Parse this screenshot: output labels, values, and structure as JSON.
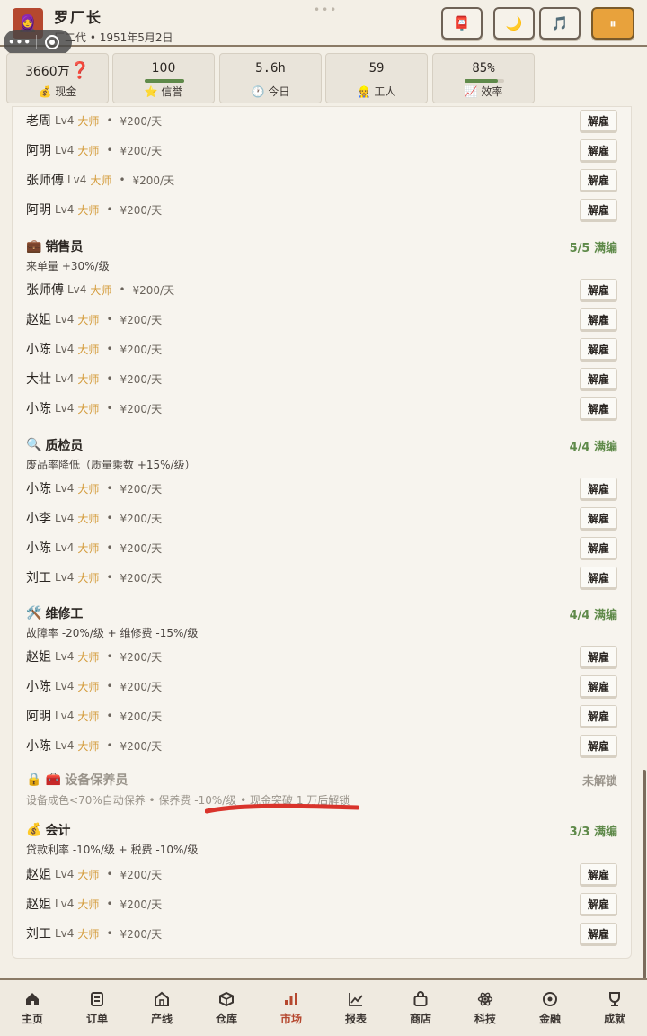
{
  "header": {
    "avatar_emoji": "🧕",
    "title": "罗厂长",
    "subtitle": "厂二代 • 1951年5月2日",
    "drag_dots": "•••",
    "capsule_dots": "•••",
    "buttons": [
      {
        "icon": "📮",
        "name": "mailbox-button"
      },
      {
        "icon": "🌙",
        "name": "night-mode-button"
      },
      {
        "icon": "🎵",
        "name": "music-button"
      },
      {
        "icon": "⏸",
        "name": "pause-button"
      }
    ]
  },
  "stats": [
    {
      "value": "3660万",
      "extra": "❓",
      "icon": "💰",
      "label": "现金"
    },
    {
      "value": "100",
      "icon": "⭐",
      "label": "信誉",
      "bar": 1.0
    },
    {
      "value": "5.6h",
      "icon": "🕐",
      "label": "今日"
    },
    {
      "value": "59",
      "icon": "👷",
      "label": "工人"
    },
    {
      "value": "85%",
      "icon": "📈",
      "label": "效率",
      "bar": 0.85
    }
  ],
  "fire_label": "解雇",
  "sections": [
    {
      "workers": [
        {
          "name": "老周",
          "level": "Lv4",
          "rank": "大师",
          "wage": "¥200/天"
        },
        {
          "name": "阿明",
          "level": "Lv4",
          "rank": "大师",
          "wage": "¥200/天"
        },
        {
          "name": "张师傅",
          "level": "Lv4",
          "rank": "大师",
          "wage": "¥200/天"
        },
        {
          "name": "阿明",
          "level": "Lv4",
          "rank": "大师",
          "wage": "¥200/天"
        }
      ]
    },
    {
      "icon": "💼",
      "title": "销售员",
      "count": "5/5 满编",
      "desc": "来单量 +30%/级",
      "workers": [
        {
          "name": "张师傅",
          "level": "Lv4",
          "rank": "大师",
          "wage": "¥200/天"
        },
        {
          "name": "赵姐",
          "level": "Lv4",
          "rank": "大师",
          "wage": "¥200/天"
        },
        {
          "name": "小陈",
          "level": "Lv4",
          "rank": "大师",
          "wage": "¥200/天"
        },
        {
          "name": "大壮",
          "level": "Lv4",
          "rank": "大师",
          "wage": "¥200/天"
        },
        {
          "name": "小陈",
          "level": "Lv4",
          "rank": "大师",
          "wage": "¥200/天"
        }
      ]
    },
    {
      "icon": "🔍",
      "title": "质检员",
      "count": "4/4 满编",
      "desc": "废品率降低（质量乘数 +15%/级）",
      "workers": [
        {
          "name": "小陈",
          "level": "Lv4",
          "rank": "大师",
          "wage": "¥200/天"
        },
        {
          "name": "小李",
          "level": "Lv4",
          "rank": "大师",
          "wage": "¥200/天"
        },
        {
          "name": "小陈",
          "level": "Lv4",
          "rank": "大师",
          "wage": "¥200/天"
        },
        {
          "name": "刘工",
          "level": "Lv4",
          "rank": "大师",
          "wage": "¥200/天"
        }
      ]
    },
    {
      "icon": "🛠️",
      "title": "维修工",
      "count": "4/4 满编",
      "desc": "故障率 -20%/级 + 维修费 -15%/级",
      "workers": [
        {
          "name": "赵姐",
          "level": "Lv4",
          "rank": "大师",
          "wage": "¥200/天"
        },
        {
          "name": "小陈",
          "level": "Lv4",
          "rank": "大师",
          "wage": "¥200/天"
        },
        {
          "name": "阿明",
          "level": "Lv4",
          "rank": "大师",
          "wage": "¥200/天"
        },
        {
          "name": "小陈",
          "level": "Lv4",
          "rank": "大师",
          "wage": "¥200/天"
        }
      ]
    },
    {
      "icon": "🔒 🧰",
      "title": "设备保养员",
      "count": "未解锁",
      "desc": "设备成色<70%自动保养 • 保养费 -10%/级 • 现金突破 1 万后解锁",
      "locked": true,
      "workers": []
    },
    {
      "icon": "💰",
      "title": "会计",
      "count": "3/3 满编",
      "desc": "贷款利率 -10%/级 + 税费 -10%/级",
      "workers": [
        {
          "name": "赵姐",
          "level": "Lv4",
          "rank": "大师",
          "wage": "¥200/天"
        },
        {
          "name": "赵姐",
          "level": "Lv4",
          "rank": "大师",
          "wage": "¥200/天"
        },
        {
          "name": "刘工",
          "level": "Lv4",
          "rank": "大师",
          "wage": "¥200/天"
        }
      ]
    }
  ],
  "nav": [
    {
      "label": "主页",
      "icon": "home-icon"
    },
    {
      "label": "订单",
      "icon": "order-icon"
    },
    {
      "label": "产线",
      "icon": "factory-icon"
    },
    {
      "label": "仓库",
      "icon": "box-icon"
    },
    {
      "label": "市场",
      "icon": "bar-chart-icon",
      "active": true
    },
    {
      "label": "报表",
      "icon": "line-chart-icon"
    },
    {
      "label": "商店",
      "icon": "shop-icon"
    },
    {
      "label": "科技",
      "icon": "atom-icon"
    },
    {
      "label": "金融",
      "icon": "coin-icon"
    },
    {
      "label": "成就",
      "icon": "trophy-icon"
    }
  ],
  "colors": {
    "accent": "#b5482f",
    "full": "#5f8a4a",
    "rank": "#d49b3a",
    "annotation": "#d9332b"
  }
}
